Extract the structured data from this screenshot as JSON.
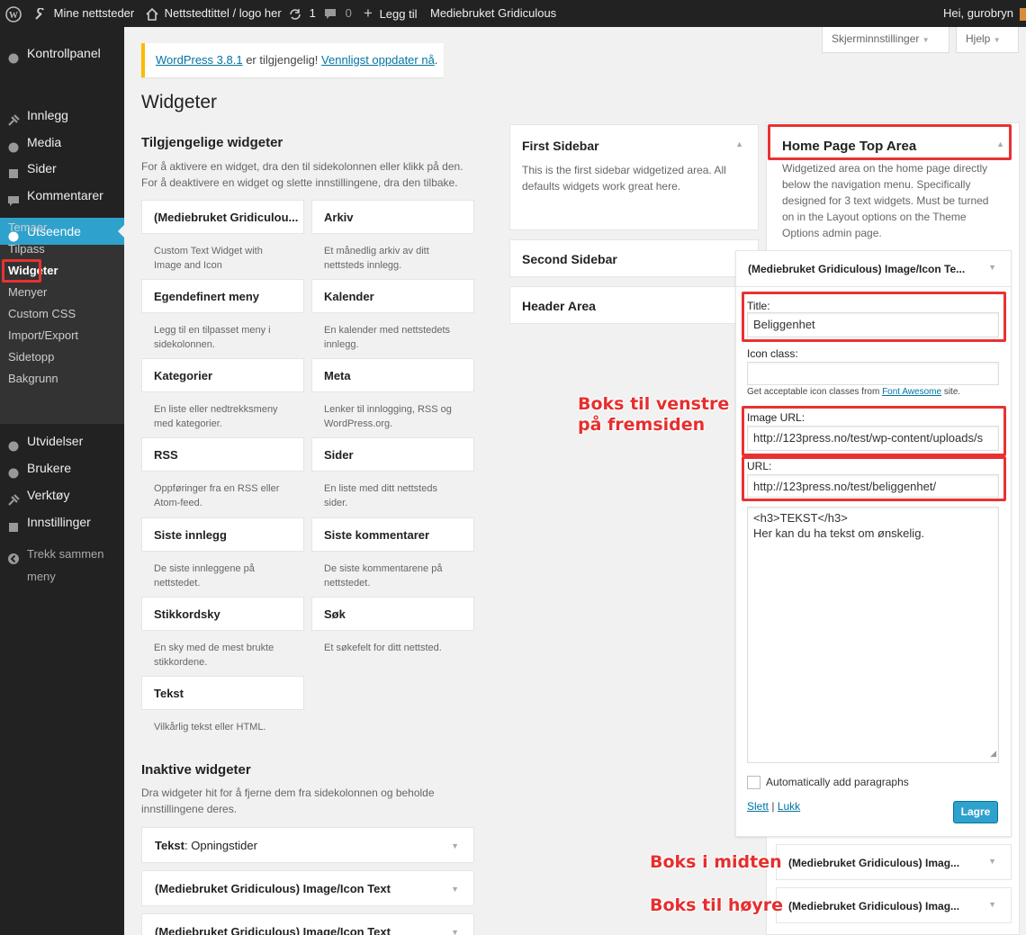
{
  "adminbar": {
    "my_sites": "Mine nettsteder",
    "site_title": "Nettstedtittel / logo her",
    "updates_count": "1",
    "comments_count": "0",
    "add_new": "Legg til",
    "theme_link": "Mediebruket Gridiculous",
    "greeting": "Hei, gurobryn"
  },
  "sidebar": {
    "items": [
      {
        "label": "Kontrollpanel",
        "icon": "dashboard-icon"
      },
      {
        "label": "Innlegg",
        "icon": "pin-icon"
      },
      {
        "label": "Media",
        "icon": "media-icon"
      },
      {
        "label": "Sider",
        "icon": "pages-icon"
      },
      {
        "label": "Kommentarer",
        "icon": "comments-icon"
      },
      {
        "label": "Utseende",
        "icon": "appearance-icon"
      },
      {
        "label": "Utvidelser",
        "icon": "plugins-icon"
      },
      {
        "label": "Brukere",
        "icon": "users-icon"
      },
      {
        "label": "Verktøy",
        "icon": "tools-icon"
      },
      {
        "label": "Innstillinger",
        "icon": "settings-icon"
      },
      {
        "label": "Trekk sammen",
        "icon": "collapse-icon"
      },
      {
        "label": "meny"
      }
    ],
    "submenu": [
      "Temaer",
      "Tilpass",
      "Widgeter",
      "Menyer",
      "Custom CSS",
      "Import/Export",
      "Sidetopp",
      "Bakgrunn"
    ]
  },
  "screen_options": "Skjerminnstillinger",
  "help": "Hjelp",
  "notice": {
    "link1": "WordPress 3.8.1",
    "middle": " er tilgjengelig! ",
    "link2": "Vennligst oppdater nå",
    "end": "."
  },
  "page_title": "Widgeter",
  "available": {
    "title": "Tilgjengelige widgeter",
    "desc1": "For å aktivere en widget, dra den til sidekolonnen eller klikk på den.",
    "desc2": "For å deaktivere en widget og slette innstillingene, dra den tilbake.",
    "widgets": [
      {
        "name": "(Mediebruket Gridiculou...",
        "desc1": "Custom Text Widget with",
        "desc2": "Image and Icon"
      },
      {
        "name": "Arkiv",
        "desc1": "Et månedlig arkiv av ditt",
        "desc2": "nettsteds innlegg."
      },
      {
        "name": "Egendefinert meny",
        "desc1": "Legg til en tilpasset meny i",
        "desc2": "sidekolonnen."
      },
      {
        "name": "Kalender",
        "desc1": "En kalender med nettstedets",
        "desc2": "innlegg."
      },
      {
        "name": "Kategorier",
        "desc1": "En liste eller nedtrekksmeny",
        "desc2": "med kategorier."
      },
      {
        "name": "Meta",
        "desc1": "Lenker til innlogging, RSS og",
        "desc2": "WordPress.org."
      },
      {
        "name": "RSS",
        "desc1": "Oppføringer fra en RSS eller",
        "desc2": "Atom-feed."
      },
      {
        "name": "Sider",
        "desc1": "En liste med ditt nettsteds",
        "desc2": "sider."
      },
      {
        "name": "Siste innlegg",
        "desc1": "De siste innleggene på",
        "desc2": "nettstedet."
      },
      {
        "name": "Siste kommentarer",
        "desc1": "De siste kommentarene på",
        "desc2": "nettstedet."
      },
      {
        "name": "Stikkordsky",
        "desc1": "En sky med de mest brukte",
        "desc2": "stikkordene."
      },
      {
        "name": "Søk",
        "desc1": "Et søkefelt for ditt nettsted.",
        "desc2": ""
      },
      {
        "name": "Tekst",
        "desc1": "Vilkårlig tekst eller HTML.",
        "desc2": ""
      }
    ]
  },
  "inactive": {
    "title": "Inaktive widgeter",
    "desc1": "Dra widgeter hit for å fjerne dem fra sidekolonnen og beholde",
    "desc2": "innstillingene deres.",
    "items": [
      {
        "prefix": "Tekst",
        "suffix": ": Opningstider"
      },
      {
        "prefix": "(Mediebruket Gridiculous) Image/Icon Text",
        "suffix": ""
      },
      {
        "prefix": "(Mediebruket Gridiculous) Image/Icon Text",
        "suffix": ""
      }
    ]
  },
  "areas": {
    "first": {
      "title": "First Sidebar",
      "desc1": "This is the first sidebar widgetized area. All",
      "desc2": "defaults widgets work great here."
    },
    "second": {
      "title": "Second Sidebar"
    },
    "header": {
      "title": "Header Area"
    },
    "home_top": {
      "title": "Home Page Top Area",
      "desc": [
        "Widgetized area on the home page directly",
        "below the navigation menu. Specifically",
        "designed for 3 text widgets. Must be turned",
        "on in the Layout options on the Theme",
        "Options admin page."
      ]
    }
  },
  "widget_form": {
    "header": "(Mediebruket Gridiculous) Image/Icon Te...",
    "title_label": "Title:",
    "title_value": "Beliggenhet",
    "icon_label": "Icon class:",
    "icon_value": "",
    "icon_help_pre": "Get acceptable icon classes from ",
    "icon_help_link": "Font Awesome",
    "icon_help_post": " site.",
    "image_label": "Image URL:",
    "image_value": "http://123press.no/test/wp-content/uploads/s",
    "url_label": "URL:",
    "url_value": "http://123press.no/test/beliggenhet/",
    "text_line1": "<h3>TEKST</h3>",
    "text_line2": "Her kan du ha tekst om ønskelig.",
    "autop_label": "Automatically add paragraphs",
    "delete": "Slett",
    "close": "Lukk",
    "save": "Lagre"
  },
  "collapsed_widgets": [
    {
      "label": "(Mediebruket Gridiculous) Imag..."
    },
    {
      "label": "(Mediebruket Gridiculous) Imag..."
    }
  ],
  "annotations": {
    "left_line1": "Boks til venstre",
    "left_line2": "på fremsiden",
    "middle": "Boks i midten",
    "right": "Boks til høyre"
  },
  "colors": {
    "accent": "#2ea2cc",
    "annotation_red": "#e62e2e",
    "adminbar": "#222222"
  }
}
